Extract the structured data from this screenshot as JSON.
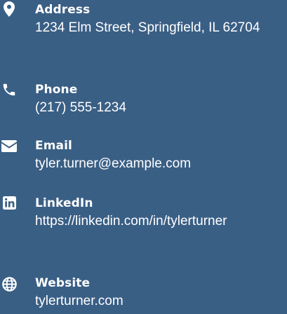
{
  "theme": {
    "background": "#3a5f85",
    "text": "#ffffff"
  },
  "contacts": [
    {
      "icon": "map-marker-icon",
      "label": "Address",
      "value": "1234 Elm Street, Springfield, IL 62704"
    },
    {
      "icon": "phone-icon",
      "label": "Phone",
      "value": "(217) 555-1234"
    },
    {
      "icon": "envelope-icon",
      "label": "Email",
      "value": "tyler.turner@example.com"
    },
    {
      "icon": "linkedin-icon",
      "label": "LinkedIn",
      "value": "https://linkedin.com/in/tylerturner"
    },
    {
      "icon": "globe-icon",
      "label": "Website",
      "value": "tylerturner.com"
    }
  ]
}
